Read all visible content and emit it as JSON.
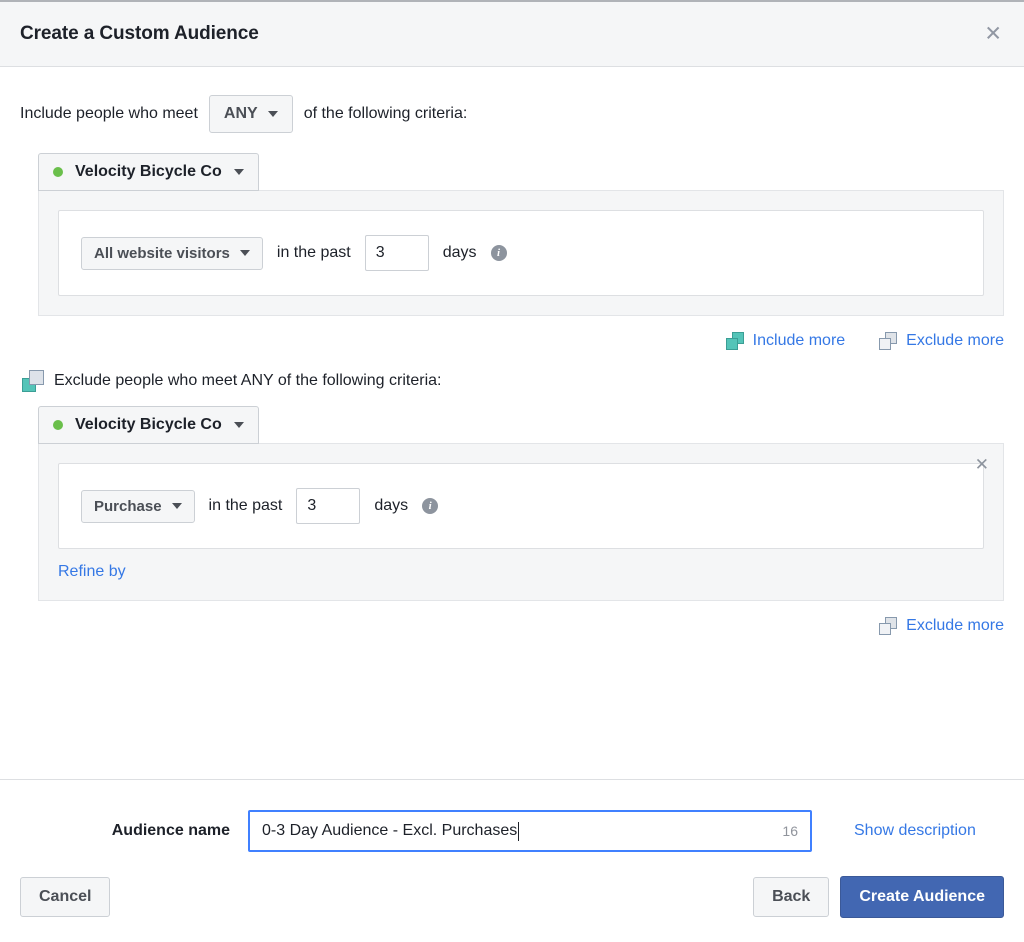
{
  "header": {
    "title": "Create a Custom Audience",
    "close_icon": "close-icon"
  },
  "intro": {
    "prefix": "Include people who meet",
    "operator": "ANY",
    "suffix": "of the following criteria:"
  },
  "include_group": {
    "source_label": "Velocity Bicycle Co",
    "status_dot_color": "#6abf4b",
    "rule": {
      "event_label": "All website visitors",
      "between_label": "in the past",
      "value": "3",
      "unit_label": "days",
      "info_icon": "info-icon"
    }
  },
  "more_links": {
    "include_more": "Include more",
    "exclude_more": "Exclude more",
    "include_icon": "include-squares-icon",
    "exclude_icon": "exclude-squares-icon"
  },
  "exclude_group": {
    "header_icon": "exclude-squares-icon",
    "header_text": "Exclude people who meet ANY of the following criteria:",
    "source_label": "Velocity Bicycle Co",
    "status_dot_color": "#6abf4b",
    "close_icon": "close-icon",
    "rule": {
      "event_label": "Purchase",
      "between_label": "in the past",
      "value": "3",
      "unit_label": "days",
      "info_icon": "info-icon"
    },
    "refine_label": "Refine by"
  },
  "bottom_more": {
    "exclude_more": "Exclude more",
    "exclude_icon": "exclude-squares-icon"
  },
  "name_section": {
    "label": "Audience name",
    "value": "0-3 Day Audience - Excl. Purchases",
    "placeholder": "Audience name",
    "char_count": "16",
    "show_description": "Show description"
  },
  "footer": {
    "cancel": "Cancel",
    "back": "Back",
    "create": "Create Audience"
  },
  "colors": {
    "accent_link": "#3578e5",
    "primary_button": "#4267b2",
    "panel_gray": "#f5f6f7",
    "teal": "#54c4b8",
    "green": "#6abf4b"
  }
}
